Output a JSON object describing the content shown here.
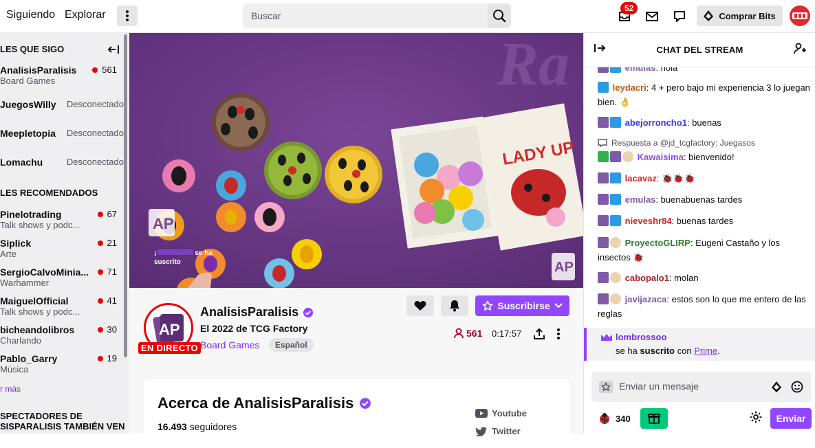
{
  "nav": {
    "following": "Siguiendo",
    "explore": "Explorar",
    "search_placeholder": "Buscar",
    "notifications_count": "52",
    "bits_label": "Comprar Bits"
  },
  "sidebar": {
    "followed_title": "LES QUE SIGO",
    "followed": [
      {
        "name": "AnalisisParalisis",
        "category": "Board Games",
        "viewers": "561",
        "live": true
      },
      {
        "name": "JuegosWilly",
        "status": "Desconectado",
        "live": false
      },
      {
        "name": "Meepletopia",
        "status": "Desconectado",
        "live": false
      },
      {
        "name": "Lomachu",
        "status": "Desconectado",
        "live": false
      }
    ],
    "recommended_title": "LES RECOMENDADOS",
    "recommended": [
      {
        "name": "Pinelotrading",
        "category": "Talk shows y podc...",
        "viewers": "67"
      },
      {
        "name": "Siplick",
        "category": "Arte",
        "viewers": "21"
      },
      {
        "name": "SergioCalvoMinia...",
        "category": "Warhammer",
        "viewers": "71"
      },
      {
        "name": "MaiguelOfficial",
        "category": "Talk shows y podc...",
        "viewers": "41"
      },
      {
        "name": "bicheandolibros",
        "category": "Charlando",
        "viewers": "30"
      },
      {
        "name": "Pablo_Garry",
        "category": "Música",
        "viewers": "19"
      }
    ],
    "show_more": "r más",
    "also_watch_line1": "SPECTADORES DE",
    "also_watch_line2": "SISPARALISIS TAMBIÉN VEN"
  },
  "video": {
    "overlay_line1": "¡",
    "overlay_line2": "se ha",
    "overlay_line3": "suscrito",
    "box_title": "LADY UP"
  },
  "stream": {
    "channel": "AnalisisParalisis",
    "live_badge": "EN DIRECTO",
    "title": "El 2022 de TCG Factory",
    "category": "Board Games",
    "language": "Español",
    "subscribe": "Suscribirse",
    "viewers": "561",
    "uptime": "0:17:57"
  },
  "about": {
    "title": "Acerca de AnalisisParalisis",
    "followers_count": "16.493",
    "followers_label": "seguidores",
    "links": [
      "Youtube",
      "Twitter"
    ]
  },
  "chat": {
    "title": "CHAT DEL STREAM",
    "messages": [
      {
        "user": "emulas",
        "color": "#7d5ba6",
        "text": ": hola"
      },
      {
        "user": "leydacri",
        "color": "#c15a0f",
        "text": ": 4 + pero bajo mi experiencia 3 lo juegan bien. 👌"
      },
      {
        "user": "abejorroncho1",
        "color": "#3a3ad6",
        "text": ": buenas"
      },
      {
        "reply": "Respuesta a @jd_tcgfactory: Juegasos",
        "user": "Kawaisima",
        "color": "#9147ff",
        "text": ": bienvenido!"
      },
      {
        "user": "lacavaz",
        "color": "#d12525",
        "text": ": 🐞🐞🐞"
      },
      {
        "user": "emulas",
        "color": "#7d5ba6",
        "text": ": buenabuenas tardes"
      },
      {
        "user": "nieveshr84",
        "color": "#d12525",
        "text": ": buenas tardes"
      },
      {
        "user": "ProyectoGLIRP",
        "color": "#2e7d32",
        "text": ": Eugeni Castaño y los insectos 🐞"
      },
      {
        "user": "cabopalo1",
        "color": "#b22222",
        "text": ": molan"
      },
      {
        "user": "javijazaca",
        "color": "#7d5ba6",
        "text": ": estos son lo que me entero de las reglas"
      }
    ],
    "resub": {
      "user": "lombrossoo",
      "text_pre": "se ha ",
      "text_bold": "suscrito",
      "text_mid": " con ",
      "text_link": "Prime",
      "text_post": "."
    },
    "input_placeholder": "Enviar un mensaje",
    "points": "340",
    "send": "Enviar"
  },
  "colors": {
    "accent": "#9147ff",
    "live": "#eb0400",
    "video_bg": "#6e3b8a"
  }
}
